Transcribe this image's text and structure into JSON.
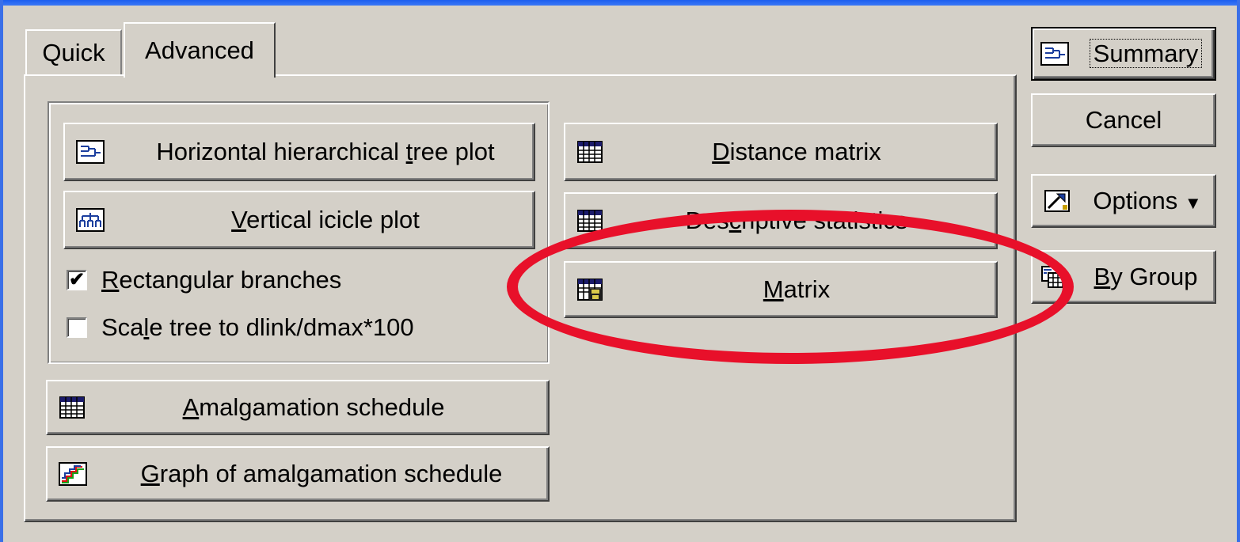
{
  "tabs": [
    {
      "label": "Quick"
    },
    {
      "label": "Advanced"
    }
  ],
  "left_group": {
    "tree_plot_button": {
      "label_pre": "Horizontal hierarchical ",
      "label_u": "t",
      "label_post": "ree plot",
      "icon": "tree-plot-icon"
    },
    "icicle_button": {
      "label_pre": "",
      "label_u": "V",
      "label_post": "ertical icicle plot",
      "icon": "icicle-icon"
    },
    "rectangular_branches": {
      "checked": true,
      "mark": "✔",
      "label_pre": "",
      "label_u": "R",
      "label_post": "ectangular branches"
    },
    "scale_tree": {
      "checked": false,
      "label_pre": "Sca",
      "label_u": "l",
      "label_post": "e tree to dlink/dmax*100"
    }
  },
  "amalgamation_button": {
    "label_pre": "",
    "label_u": "A",
    "label_post": "malgamation schedule",
    "icon": "spreadsheet-icon"
  },
  "graph_amalgamation_button": {
    "label_pre": "",
    "label_u": "G",
    "label_post": "raph of amalgamation schedule",
    "icon": "line-graph-icon"
  },
  "right_group": {
    "distance_matrix_button": {
      "label_pre": "",
      "label_u": "D",
      "label_post": "istance matrix",
      "icon": "spreadsheet-icon"
    },
    "descriptive_stats_button": {
      "label_pre": "Des",
      "label_u": "c",
      "label_post": "riptive statistics",
      "icon": "spreadsheet-icon"
    },
    "matrix_button": {
      "label_pre": "",
      "label_u": "M",
      "label_post": "atrix",
      "icon": "matrix-save-icon"
    }
  },
  "side_buttons": {
    "summary": {
      "label": "Summary",
      "icon": "tree-plot-icon"
    },
    "cancel": {
      "label": "Cancel"
    },
    "options": {
      "label": "Options",
      "arrow": "▼",
      "icon": "options-icon"
    },
    "by_group": {
      "label_pre": "",
      "label_u": "B",
      "label_post": "y Group",
      "icon": "by-group-icon"
    }
  },
  "colors": {
    "face": "#d4d0c8",
    "highlight_ellipse": "#e8102a",
    "title_blue": "#1c5ef0"
  }
}
